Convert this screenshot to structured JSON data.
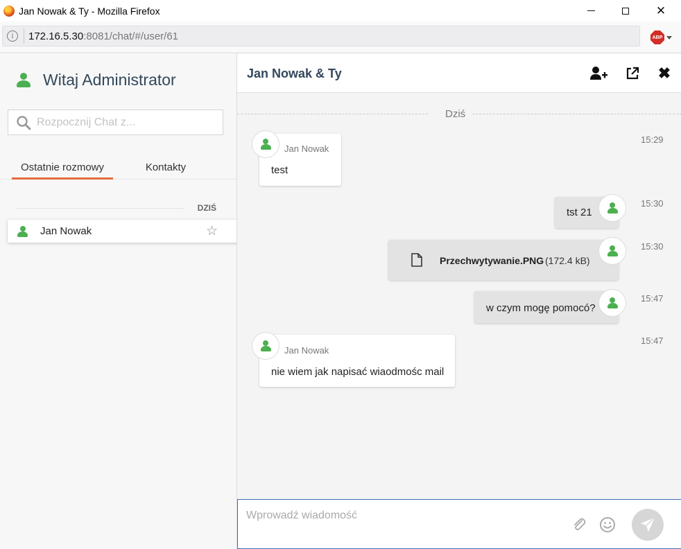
{
  "window": {
    "title": "Jan Nowak & Ty - Mozilla Firefox",
    "minimize_icon": "minimize-icon",
    "maximize_icon": "maximize-icon",
    "close_symbol": "✕"
  },
  "address_bar": {
    "url_host": "172.16.5.30",
    "url_rest": ":8081/chat/#/user/61",
    "info_symbol": "i",
    "adblock_label": "ABP"
  },
  "sidebar": {
    "greeting": "Witaj Administrator",
    "search_placeholder": "Rozpocznij Chat z...",
    "tabs": [
      {
        "label": "Ostatnie rozmowy",
        "active": true
      },
      {
        "label": "Kontakty",
        "active": false
      }
    ],
    "day_label": "DZIŚ",
    "contacts": [
      {
        "name": "Jan Nowak",
        "starred": false,
        "star_symbol": "☆"
      }
    ]
  },
  "chat": {
    "title": "Jan Nowak & Ty",
    "date_separator": "Dziś",
    "close_symbol": "✖",
    "messages": [
      {
        "direction": "in",
        "sender": "Jan Nowak",
        "text": "test",
        "time": "15:29"
      },
      {
        "direction": "out",
        "text": "tst 21",
        "time": "15:30"
      },
      {
        "direction": "out",
        "file_name": "Przechwytywanie.PNG",
        "file_size": "(172.4 kB)",
        "time": "15:30"
      },
      {
        "direction": "out",
        "text": "w czym mogę pomocó?",
        "time": "15:47"
      },
      {
        "direction": "in",
        "sender": "Jan Nowak",
        "text": "nie wiem jak napisać wiaodmośc mail",
        "time": "15:47"
      }
    ],
    "compose_placeholder": "Wprowadź wiadomość"
  },
  "colors": {
    "accent_tab": "#e36d3a",
    "user_icon": "#4caf50",
    "title_text": "#33475b"
  }
}
